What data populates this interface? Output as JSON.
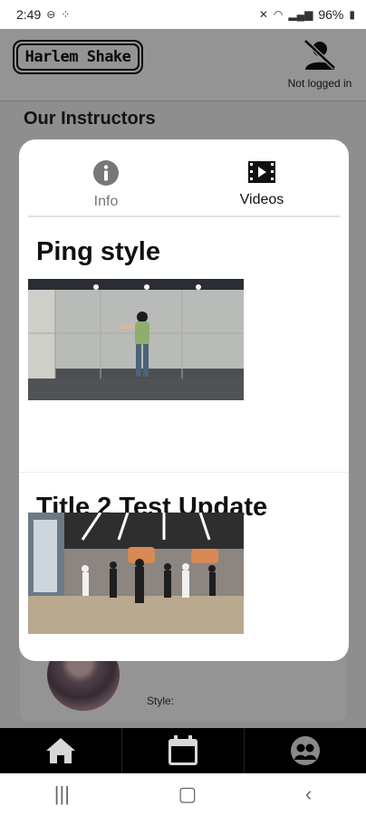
{
  "status_bar": {
    "time": "2:49",
    "battery": "96%"
  },
  "header": {
    "logo_text": "Harlem Shake",
    "login_status": "Not logged in"
  },
  "page": {
    "section_title": "Our Instructors",
    "style_label": "Style:"
  },
  "modal": {
    "tabs": [
      {
        "label": "Info",
        "icon": "info-icon",
        "active": false
      },
      {
        "label": "Videos",
        "icon": "film-icon",
        "active": true
      }
    ],
    "videos": [
      {
        "title": "Ping style"
      },
      {
        "title": "Title 2 Test Update"
      }
    ]
  },
  "bottom_nav": {
    "icons": [
      "home-icon",
      "calendar-icon",
      "group-icon"
    ]
  },
  "colors": {
    "nav_bg": "#000000",
    "overlay": "rgba(0,0,0,0.42)",
    "modal_bg": "#ffffff"
  }
}
